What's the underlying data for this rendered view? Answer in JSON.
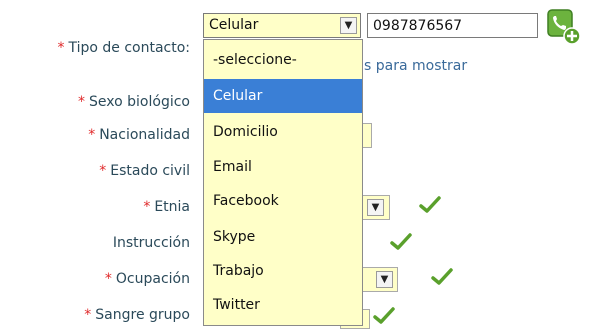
{
  "form": {
    "labels": {
      "tipo_contacto": "Tipo de contacto:",
      "sexo": "Sexo biológico",
      "nacionalidad": "Nacionalidad",
      "estado_civil": "Estado civil",
      "etnia": "Etnia",
      "instruccion": "Instrucción",
      "ocupacion": "Ocupación",
      "sangre": "Sangre grupo"
    },
    "required_marker": "*",
    "contact_type_value": "Celular",
    "phone_value": "0987876567",
    "hint_fragment": "s para mostrar"
  },
  "dropdown": {
    "options": [
      "-seleccione-",
      "Celular",
      "Domicilio",
      "Email",
      "Facebook",
      "Skype",
      "Trabajo",
      "Twitter"
    ],
    "selected": "Celular"
  },
  "icons": {
    "dropdown_arrow": "chevron-down-icon",
    "add_phone": "add-phone-icon",
    "valid": "checkmark-icon"
  },
  "colors": {
    "required": "#e0292a",
    "label": "#2b4a5a",
    "field_bg": "#ffffc8",
    "selected_option": "#3a7fd6",
    "check": "#5aa02c"
  }
}
